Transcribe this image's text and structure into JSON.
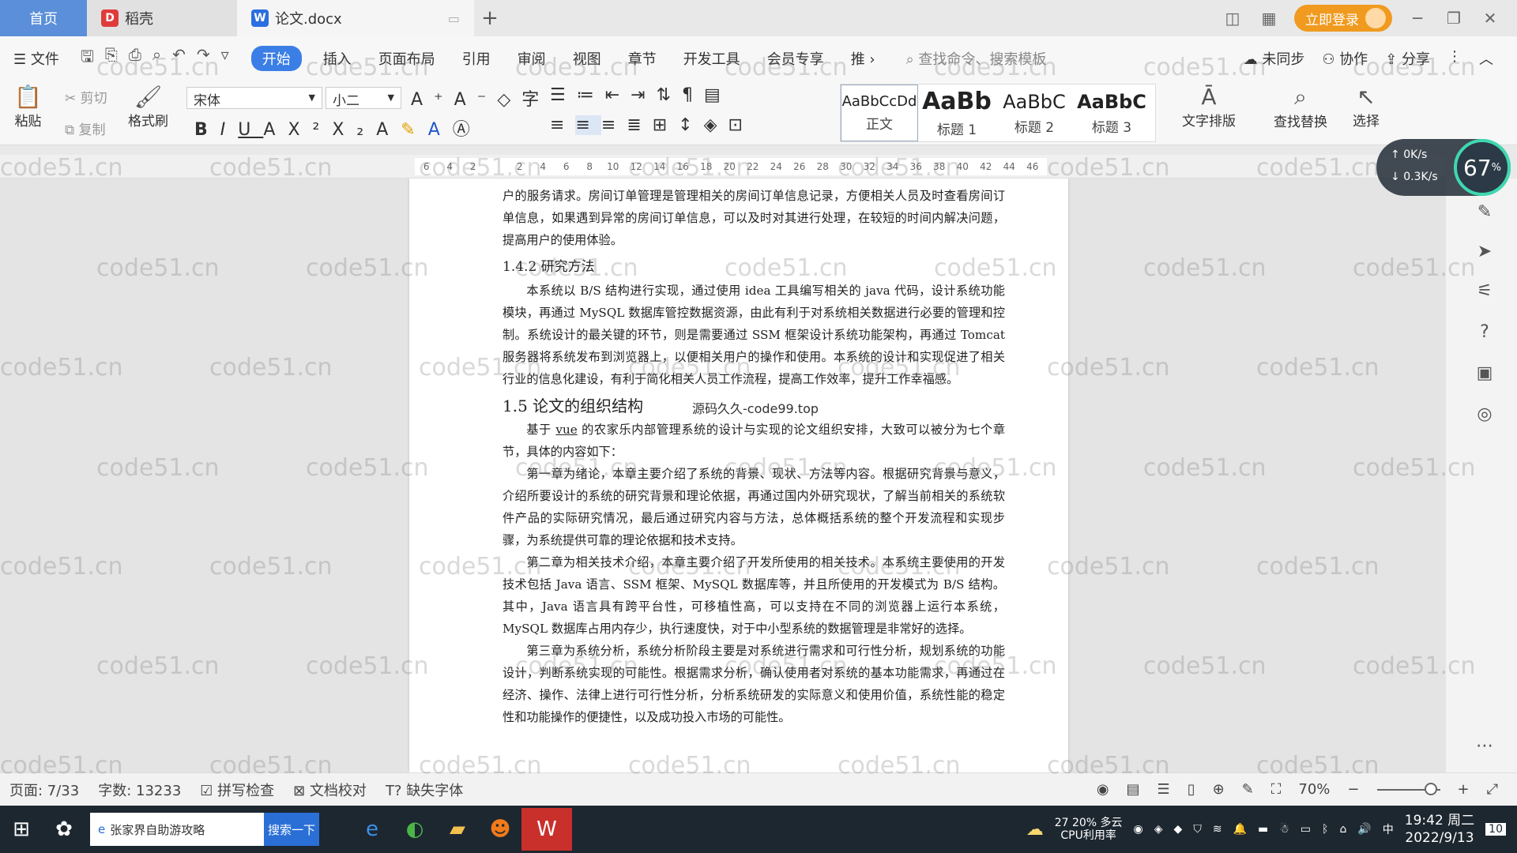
{
  "tabs": [
    {
      "label": "首页"
    },
    {
      "label": "稻壳"
    },
    {
      "label": "论文.docx"
    }
  ],
  "titlebar": {
    "login_label": "立即登录"
  },
  "menu": {
    "file": "文件",
    "items": [
      "开始",
      "插入",
      "页面布局",
      "引用",
      "审阅",
      "视图",
      "章节",
      "开发工具",
      "会员专享",
      "推"
    ],
    "search_cmd": "查找命令、搜索模板",
    "right": [
      "未同步",
      "协作",
      "分享"
    ]
  },
  "ribbon": {
    "paste": "粘贴",
    "cut": "剪切",
    "copy": "复制",
    "format_painter": "格式刷",
    "font_name": "宋体",
    "font_size": "小二",
    "styles": [
      {
        "preview": "AaBbCcDd",
        "name": "正文"
      },
      {
        "preview": "AaBb",
        "name": "标题 1"
      },
      {
        "preview": "AaBbC",
        "name": "标题 2"
      },
      {
        "preview": "AaBbC",
        "name": "标题 3"
      }
    ],
    "text_layout": "文字排版",
    "find_replace": "查找替换",
    "select": "选择"
  },
  "ruler_ticks": [
    "6",
    "4",
    "2",
    "",
    "2",
    "4",
    "6",
    "8",
    "10",
    "12",
    "14",
    "16",
    "18",
    "20",
    "22",
    "24",
    "26",
    "28",
    "30",
    "32",
    "34",
    "36",
    "38",
    "40",
    "42",
    "44",
    "46"
  ],
  "speed": {
    "up": "0K/s",
    "down": "0.3K/s",
    "cpu": "67"
  },
  "document": {
    "top_line": "户的服务请求。房间订单管理是管理相关的房间订单信息记录，方便相关人员及时查看房间订单信息，如果遇到异常的房间订单信息，可以及时对其进行处理，在较短的时间内解决问题，提高用户的使用体验。",
    "h142": "1.4.2 研究方法",
    "p_method": "本系统以 B/S 结构进行实现，通过使用 idea 工具编写相关的 java 代码，设计系统功能模块，再通过 MySQL 数据库管控数据资源，由此有利于对系统相关数据进行必要的管理和控制。系统设计的最关键的环节，则是需要通过 SSM 框架设计系统功能架构，再通过 Tomcat 服务器将系统发布到浏览器上，以便相关用户的操作和使用。本系统的设计和实现促进了相关行业的信息化建设，有利于简化相关人员工作流程，提高工作效率，提升工作幸福感。",
    "h15": "1.5 论文的组织结构",
    "inline_watermark": "源码久久-code99.top",
    "p_intro_a": "基于 ",
    "p_intro_vue": "vue",
    "p_intro_b": " 的农家乐内部管理系统的设计与实现的论文组织安排，大致可以被分为七个章节，具体的内容如下：",
    "p_ch1": "第一章为绪论，本章主要介绍了系统的背景、现状、方法等内容。根据研究背景与意义，介绍所要设计的系统的研究背景和理论依据，再通过国内外研究现状，了解当前相关的系统软件产品的实际研究情况，最后通过研究内容与方法，总体概括系统的整个开发流程和实现步骤，为系统提供可靠的理论依据和技术支持。",
    "p_ch2": "第二章为相关技术介绍，本章主要介绍了开发所使用的相关技术。本系统主要使用的开发技术包括 Java 语言、SSM 框架、MySQL 数据库等，并且所使用的开发模式为 B/S 结构。其中，Java 语言具有跨平台性，可移植性高，可以支持在不同的浏览器上运行本系统，MySQL 数据库占用内存少，执行速度快，对于中小型系统的数据管理是非常好的选择。",
    "p_ch3": "第三章为系统分析，系统分析阶段主要是对系统进行需求和可行性分析，规划系统的功能设计，判断系统实现的可能性。根据需求分析，确认使用者对系统的基本功能需求，再通过在经济、操作、法律上进行可行性分析，分析系统研发的实际意义和使用价值，系统性能的稳定性和功能操作的便捷性，以及成功投入市场的可能性。"
  },
  "statusbar": {
    "page": "页面: 7/33",
    "words": "字数: 13233",
    "spell": "拼写检查",
    "proof": "文档校对",
    "missing_font": "缺失字体",
    "zoom": "70%"
  },
  "taskbar": {
    "search_text": "张家界自助游攻略",
    "search_btn": "搜索一下",
    "weather_pct": "20%",
    "weather_label": "多云",
    "cpu_label": "CPU利用率",
    "temp": "27",
    "ime": "中",
    "time": "19:42 周二",
    "date": "2022/9/13",
    "notif": "10"
  },
  "watermark_text": "code51.cn"
}
